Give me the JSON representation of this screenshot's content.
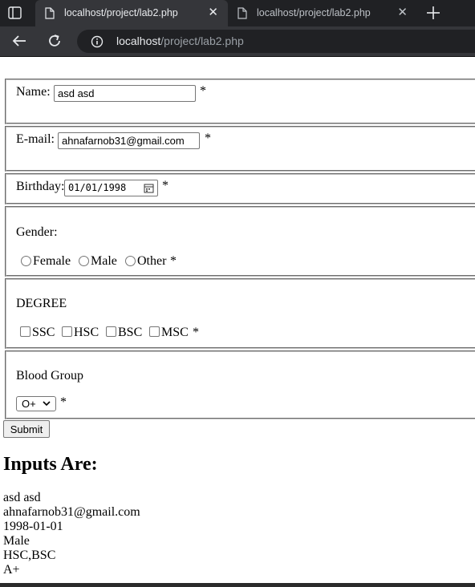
{
  "browser": {
    "tabs": [
      {
        "title": "localhost/project/lab2.php",
        "active": true
      },
      {
        "title": "localhost/project/lab2.php",
        "active": false
      }
    ],
    "url_host": "localhost",
    "url_path": "/project/lab2.php"
  },
  "form": {
    "name_label": "Name:",
    "name_value": "asd asd",
    "email_label": "E-mail:",
    "email_value": "ahnafarnob31@gmail.com",
    "birthday_label": "Birthday:",
    "birthday_value": "01/01/1998",
    "gender_label": "Gender:",
    "gender_options": [
      "Female",
      "Male",
      "Other"
    ],
    "degree_label": "DEGREE",
    "degree_options": [
      "SSC",
      "HSC",
      "BSC",
      "MSC"
    ],
    "blood_label": "Blood Group",
    "blood_selected": "O+",
    "required_mark": "*",
    "submit_label": "Submit"
  },
  "results": {
    "heading": "Inputs Are:",
    "lines": [
      "asd asd",
      "ahnafarnob31@gmail.com",
      "1998-01-01",
      "Male",
      "HSC,BSC",
      "A+"
    ]
  }
}
